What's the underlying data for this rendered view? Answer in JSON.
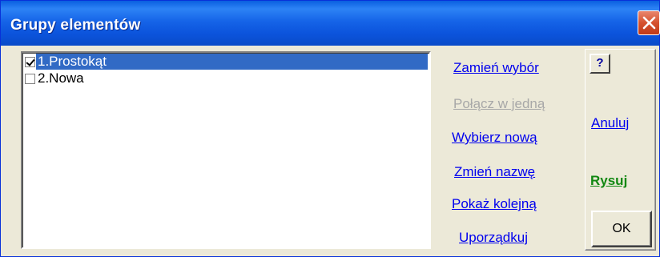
{
  "window": {
    "title": "Grupy elementów",
    "close_icon": "close-icon"
  },
  "list": {
    "items": [
      {
        "label": "1.Prostokąt",
        "checked": true,
        "selected": true
      },
      {
        "label": "2.Nowa",
        "checked": false,
        "selected": false
      }
    ]
  },
  "actions": {
    "swap_selection": "Zamień wybór",
    "merge_into_one": "Połącz w jedną",
    "select_new": "Wybierz nową",
    "rename": "Zmień nazwę",
    "show_next": "Pokaż kolejną",
    "sort": "Uporządkuj"
  },
  "side": {
    "help": "?",
    "cancel": "Anuluj",
    "draw": "Rysuj",
    "ok": "OK"
  },
  "colors": {
    "title_bar": "#0a5fe0",
    "selection": "#316ac5",
    "link": "#0000ee",
    "link_disabled": "#a8a8a8",
    "draw_link": "#118811",
    "close_button": "#d5522f"
  }
}
